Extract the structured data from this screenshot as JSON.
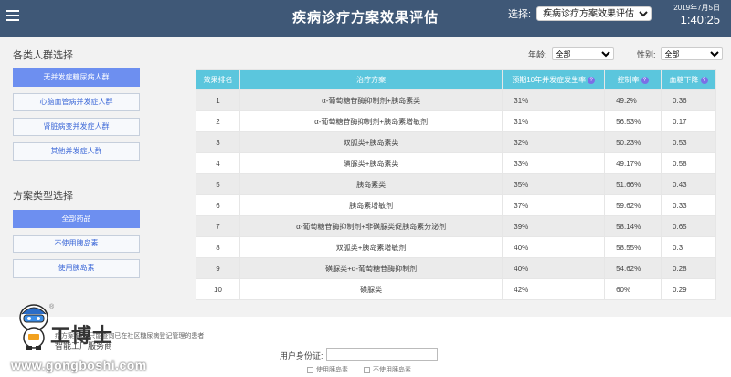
{
  "header": {
    "title": "疾病诊疗方案效果评估",
    "select_label": "选择:",
    "select_value": "疾病诊疗方案效果评估",
    "date": "2019年7月5日",
    "time": "1:40:25"
  },
  "sidebar": {
    "group_title": "各类人群选择",
    "groups": [
      {
        "label": "无并发症糖尿病人群"
      },
      {
        "label": "心脑血管病并发症人群"
      },
      {
        "label": "肾脏病变并发症人群"
      },
      {
        "label": "其他并发症人群"
      }
    ],
    "plan_title": "方案类型选择",
    "plans": [
      {
        "label": "全部药品"
      },
      {
        "label": "不使用胰岛素"
      },
      {
        "label": "使用胰岛素"
      }
    ]
  },
  "filters": {
    "age_label": "年龄:",
    "age_value": "全部",
    "gender_label": "性别:",
    "gender_value": "全部"
  },
  "table": {
    "columns": [
      "效果排名",
      "治疗方案",
      "预期10年并发症发生率",
      "控制率",
      "血糖下降"
    ],
    "rows": [
      {
        "rank": "1",
        "plan": "α-葡萄糖苷酶抑制剂+胰岛素类",
        "rate10": "31%",
        "control": "49.2%",
        "drop": "0.36"
      },
      {
        "rank": "2",
        "plan": "α-葡萄糖苷酶抑制剂+胰岛素增敏剂",
        "rate10": "31%",
        "control": "56.53%",
        "drop": "0.17"
      },
      {
        "rank": "3",
        "plan": "双胍类+胰岛素类",
        "rate10": "32%",
        "control": "50.23%",
        "drop": "0.53"
      },
      {
        "rank": "4",
        "plan": "磺脲类+胰岛素类",
        "rate10": "33%",
        "control": "49.17%",
        "drop": "0.58"
      },
      {
        "rank": "5",
        "plan": "胰岛素类",
        "rate10": "35%",
        "control": "51.66%",
        "drop": "0.43"
      },
      {
        "rank": "6",
        "plan": "胰岛素增敏剂",
        "rate10": "37%",
        "control": "59.62%",
        "drop": "0.33"
      },
      {
        "rank": "7",
        "plan": "α-葡萄糖苷酶抑制剂+非磺脲类促胰岛素分泌剂",
        "rate10": "39%",
        "control": "58.14%",
        "drop": "0.65"
      },
      {
        "rank": "8",
        "plan": "双胍类+胰岛素增敏剂",
        "rate10": "40%",
        "control": "58.55%",
        "drop": "0.3"
      },
      {
        "rank": "9",
        "plan": "磺脲类+α-葡萄糖苷酶抑制剂",
        "rate10": "40%",
        "control": "54.62%",
        "drop": "0.28"
      },
      {
        "rank": "10",
        "plan": "磺脲类",
        "rate10": "42%",
        "control": "60%",
        "drop": "0.29"
      }
    ],
    "help_glyph": "?"
  },
  "bottom": {
    "note": "疗方案推荐(只能查询已在社区糖尿病登记管理的患者",
    "id_label": "用户身份证:",
    "check_use": "使用胰岛素",
    "check_nouse": "不使用胰岛素"
  },
  "watermark": {
    "reg": "®",
    "brand": "工博士",
    "sub": "智能工厂服务商",
    "url": "www.gongboshi.com"
  },
  "icons": [
    "menu-icon",
    "select-arrows-icon",
    "help-icon",
    "mascot-icon"
  ],
  "colors": {
    "topbar": "#3f5877",
    "table_header": "#5bc6dd",
    "active_button": "#6d8ff0",
    "help_badge": "#7b6fe6"
  }
}
